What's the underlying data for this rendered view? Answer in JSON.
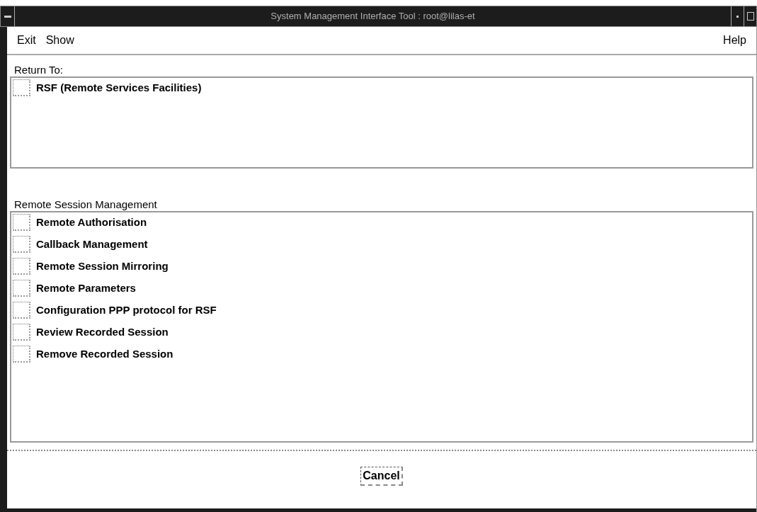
{
  "window": {
    "title": "System Management Interface Tool : root@lilas-et"
  },
  "menu": [
    {
      "label": "Exit"
    },
    {
      "label": "Show"
    },
    {
      "label": "Help"
    }
  ],
  "sections": [
    {
      "title": "Return To:",
      "items": [
        {
          "label": "RSF (Remote Services Facilities)"
        }
      ]
    },
    {
      "title": "Remote Session Management",
      "items": [
        {
          "label": "Remote Authorisation"
        },
        {
          "label": "Callback Management"
        },
        {
          "label": "Remote Session Mirroring"
        },
        {
          "label": "Remote Parameters"
        },
        {
          "label": "Configuration PPP protocol for RSF"
        },
        {
          "label": "Review Recorded Session"
        },
        {
          "label": "Remove Recorded Session"
        }
      ]
    }
  ],
  "buttons": [
    {
      "label": "Cancel"
    }
  ]
}
